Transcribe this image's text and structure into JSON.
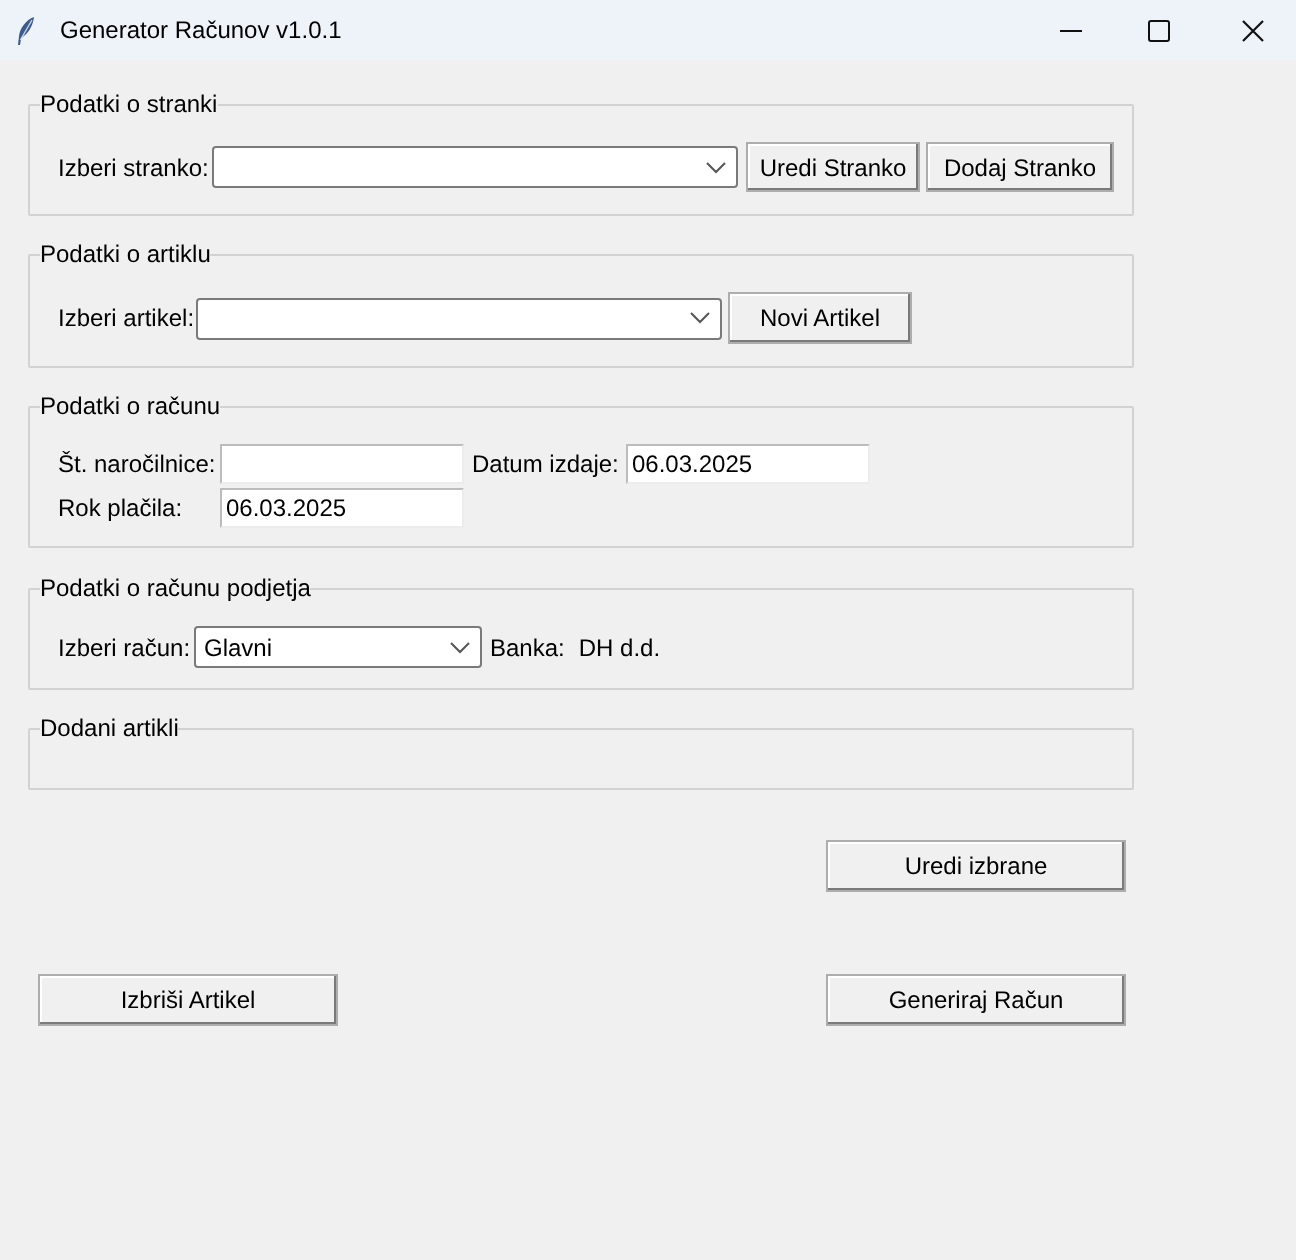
{
  "window": {
    "title": "Generator Računov v1.0.1"
  },
  "client_section": {
    "title": "Podatki o stranki",
    "select_label": "Izberi stranko:",
    "buttons": [
      "Uredi Stranko",
      "Dodaj Stranko"
    ]
  },
  "article_section": {
    "title": "Podatki o artiklu",
    "select_label": "Izberi artikel:",
    "buttons": [
      "Novi Artikel"
    ]
  },
  "invoice_section": {
    "title": "Podatki o računu",
    "fields": [
      {
        "label": "Št. naročilnice:"
      },
      {
        "label": "Datum izdaje:",
        "value": "06.03.2025"
      },
      {
        "label": "Rok plačila:",
        "value": "06.03.2025"
      }
    ]
  },
  "company_account_section": {
    "title": "Podatki o računu podjetja",
    "select_label": "Izberi račun:",
    "select_value": "Glavni",
    "bank_label": "Banka:",
    "bank_value": "DH d.d."
  },
  "added_items_section": {
    "title": "Dodani artikli"
  },
  "actions": {
    "edit_selected": "Uredi izbrane",
    "delete_article": "Izbriši Artikel",
    "generate_invoice": "Generiraj Račun"
  }
}
